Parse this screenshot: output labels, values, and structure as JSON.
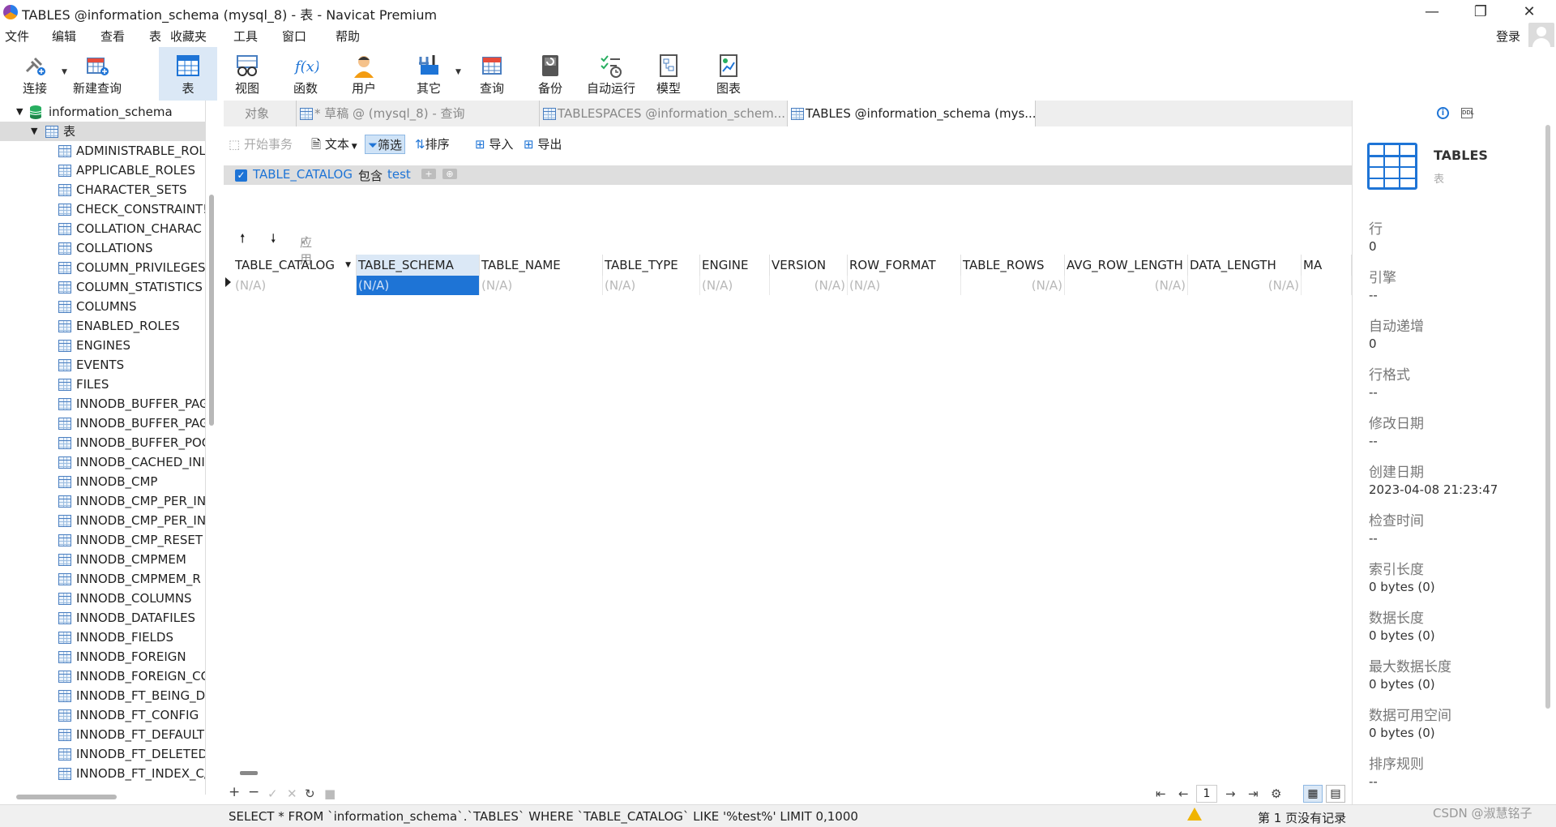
{
  "window": {
    "title": "TABLES @information_schema (mysql_8) - 表 - Navicat Premium",
    "controls": [
      "—",
      "❐",
      "✕"
    ]
  },
  "menu": [
    "文件",
    "编辑",
    "查看",
    "表",
    "收藏夹",
    "工具",
    "窗口",
    "帮助"
  ],
  "account": {
    "login_label": "登录"
  },
  "toolbar": [
    {
      "label": "连接",
      "icon": "plug-icon"
    },
    {
      "label": "新建查询",
      "icon": "new-query-icon"
    },
    {
      "label": "表",
      "icon": "table-icon",
      "active": true
    },
    {
      "label": "视图",
      "icon": "view-icon"
    },
    {
      "label": "函数",
      "icon": "function-icon"
    },
    {
      "label": "用户",
      "icon": "user-icon"
    },
    {
      "label": "其它",
      "icon": "tools-icon"
    },
    {
      "label": "查询",
      "icon": "query-icon"
    },
    {
      "label": "备份",
      "icon": "backup-icon"
    },
    {
      "label": "自动运行",
      "icon": "schedule-icon"
    },
    {
      "label": "模型",
      "icon": "model-icon"
    },
    {
      "label": "图表",
      "icon": "chart-icon"
    }
  ],
  "tree": {
    "database": "information_schema",
    "folder": "表",
    "tables": [
      "ADMINISTRABLE_ROL",
      "APPLICABLE_ROLES",
      "CHARACTER_SETS",
      "CHECK_CONSTRAINT!",
      "COLLATION_CHARAC",
      "COLLATIONS",
      "COLUMN_PRIVILEGES",
      "COLUMN_STATISTICS",
      "COLUMNS",
      "ENABLED_ROLES",
      "ENGINES",
      "EVENTS",
      "FILES",
      "INNODB_BUFFER_PAG",
      "INNODB_BUFFER_PAG",
      "INNODB_BUFFER_POC",
      "INNODB_CACHED_INI",
      "INNODB_CMP",
      "INNODB_CMP_PER_IN",
      "INNODB_CMP_PER_IN",
      "INNODB_CMP_RESET",
      "INNODB_CMPMEM",
      "INNODB_CMPMEM_R",
      "INNODB_COLUMNS",
      "INNODB_DATAFILES",
      "INNODB_FIELDS",
      "INNODB_FOREIGN",
      "INNODB_FOREIGN_CC",
      "INNODB_FT_BEING_DI",
      "INNODB_FT_CONFIG",
      "INNODB_FT_DEFAULT",
      "INNODB_FT_DELETED",
      "INNODB_FT_INDEX_C/"
    ]
  },
  "tabs": [
    {
      "label": "对象",
      "active": false
    },
    {
      "label": "* 草稿 @ (mysql_8) - 查询",
      "active": false
    },
    {
      "label": "TABLESPACES @information_schem...",
      "active": false
    },
    {
      "label": "TABLES @information_schema (mys...",
      "active": true
    }
  ],
  "subtoolbar": [
    {
      "label": "开始事务",
      "disabled": true
    },
    {
      "label": "文本"
    },
    {
      "label": "筛选",
      "active": true
    },
    {
      "label": "排序"
    },
    {
      "label": "导入"
    },
    {
      "label": "导出"
    }
  ],
  "filter": {
    "field": "TABLE_CATALOG",
    "op": "包含",
    "value": "test",
    "add": "+",
    "more": "⊕"
  },
  "sortbar": {
    "apply": "应用"
  },
  "grid": {
    "columns": [
      "TABLE_CATALOG",
      "TABLE_SCHEMA",
      "TABLE_NAME",
      "TABLE_TYPE",
      "ENGINE",
      "VERSION",
      "ROW_FORMAT",
      "TABLE_ROWS",
      "AVG_ROW_LENGTH",
      "DATA_LENGTH",
      "MA"
    ],
    "row": [
      "(N/A)",
      "(N/A)",
      "(N/A)",
      "(N/A)",
      "(N/A)",
      "(N/A)",
      "(N/A)",
      "(N/A)",
      "(N/A)",
      "(N/A)",
      ""
    ]
  },
  "pager": {
    "page": "1"
  },
  "status": {
    "sql": "SELECT * FROM `information_schema`.`TABLES` WHERE `TABLE_CATALOG` LIKE '%test%' LIMIT 0,1000",
    "records": "第 1 页没有记录"
  },
  "info_panel": {
    "title": "TABLES",
    "subtitle": "表",
    "props": [
      {
        "label": "行",
        "value": "0"
      },
      {
        "label": "引擎",
        "value": "--"
      },
      {
        "label": "自动递增",
        "value": "0"
      },
      {
        "label": "行格式",
        "value": "--"
      },
      {
        "label": "修改日期",
        "value": "--"
      },
      {
        "label": "创建日期",
        "value": "2023-04-08 21:23:47"
      },
      {
        "label": "检查时间",
        "value": "--"
      },
      {
        "label": "索引长度",
        "value": "0 bytes (0)"
      },
      {
        "label": "数据长度",
        "value": "0 bytes (0)"
      },
      {
        "label": "最大数据长度",
        "value": "0 bytes (0)"
      },
      {
        "label": "数据可用空间",
        "value": "0 bytes (0)"
      },
      {
        "label": "排序规则",
        "value": "--"
      }
    ]
  },
  "watermark": "CSDN @淑慧铭子",
  "colors": {
    "accent": "#1e74d6",
    "selection": "#1e74d6",
    "active_bg": "#dbe8f6"
  }
}
